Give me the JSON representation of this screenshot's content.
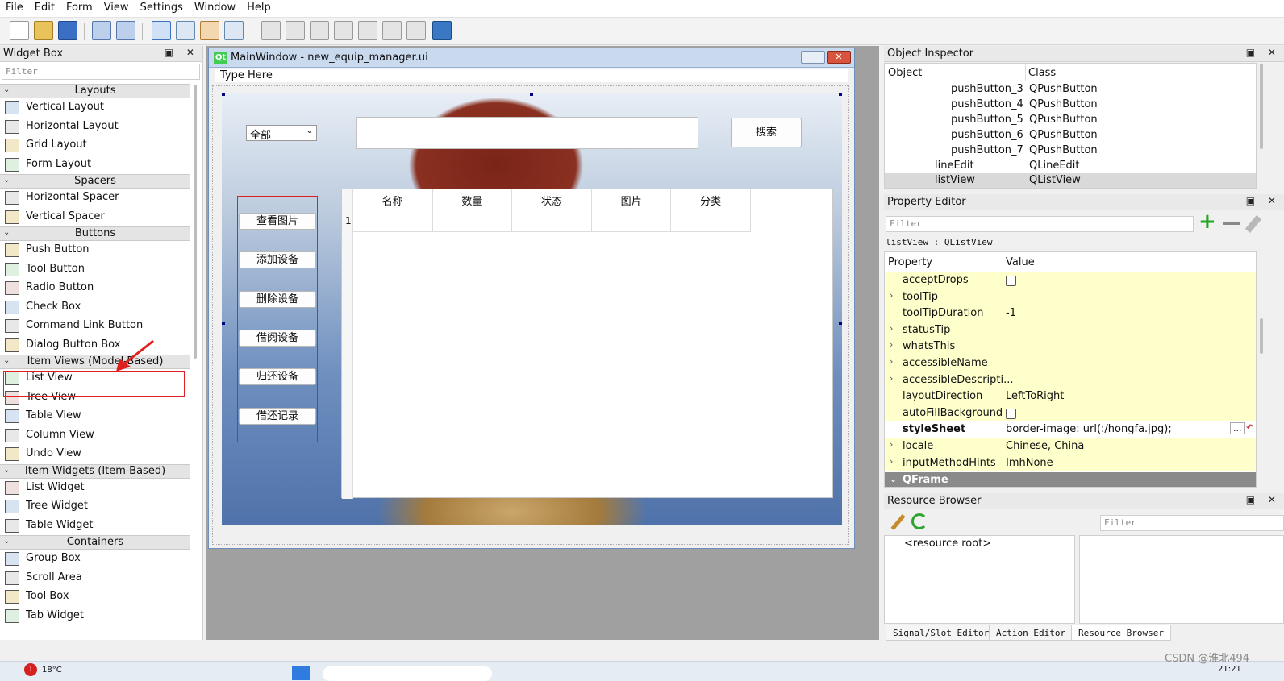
{
  "menu": [
    "File",
    "Edit",
    "Form",
    "View",
    "Settings",
    "Window",
    "Help"
  ],
  "widget_box": {
    "title": "Widget Box",
    "dock_buttons": "▣ ✕",
    "filter_placeholder": "Filter",
    "categories": [
      {
        "name": "Layouts",
        "items": [
          "Vertical Layout",
          "Horizontal Layout",
          "Grid Layout",
          "Form Layout"
        ]
      },
      {
        "name": "Spacers",
        "items": [
          "Horizontal Spacer",
          "Vertical Spacer"
        ]
      },
      {
        "name": "Buttons",
        "items": [
          "Push Button",
          "Tool Button",
          "Radio Button",
          "Check Box",
          "Command Link Button",
          "Dialog Button Box"
        ]
      },
      {
        "name": "Item Views (Model-Based)",
        "items": [
          "List View",
          "Tree View",
          "Table View",
          "Column View",
          "Undo View"
        ]
      },
      {
        "name": "Item Widgets (Item-Based)",
        "items": [
          "List Widget",
          "Tree Widget",
          "Table Widget"
        ]
      },
      {
        "name": "Containers",
        "items": [
          "Group Box",
          "Scroll Area",
          "Tool Box",
          "Tab Widget"
        ]
      }
    ]
  },
  "form": {
    "title": "MainWindow - new_equip_manager.ui",
    "qt_badge": "Qt",
    "menu_placeholder": "Type Here",
    "combo_value": "全部",
    "search_button": "搜索",
    "side_buttons": [
      "查看图片",
      "添加设备",
      "删除设备",
      "借阅设备",
      "归还设备",
      "借还记录"
    ],
    "table_headers": [
      "名称",
      "数量",
      "状态",
      "图片",
      "分类"
    ],
    "table_row_number": "1"
  },
  "object_inspector": {
    "title": "Object Inspector",
    "col_object": "Object",
    "col_class": "Class",
    "rows": [
      {
        "object": "pushButton_3",
        "class": "QPushButton"
      },
      {
        "object": "pushButton_4",
        "class": "QPushButton"
      },
      {
        "object": "pushButton_5",
        "class": "QPushButton"
      },
      {
        "object": "pushButton_6",
        "class": "QPushButton"
      },
      {
        "object": "pushButton_7",
        "class": "QPushButton"
      },
      {
        "object": "lineEdit",
        "class": "QLineEdit"
      },
      {
        "object": "listView",
        "class": "QListView"
      }
    ]
  },
  "property_editor": {
    "title": "Property Editor",
    "filter_placeholder": "Filter",
    "object_label": "listView : QListView",
    "col_property": "Property",
    "col_value": "Value",
    "rows": [
      {
        "name": "acceptDrops",
        "value": "",
        "checkbox": true,
        "expand": false
      },
      {
        "name": "toolTip",
        "value": "",
        "checkbox": false,
        "expand": true
      },
      {
        "name": "toolTipDuration",
        "value": "-1",
        "checkbox": false,
        "expand": false
      },
      {
        "name": "statusTip",
        "value": "",
        "checkbox": false,
        "expand": true
      },
      {
        "name": "whatsThis",
        "value": "",
        "checkbox": false,
        "expand": true
      },
      {
        "name": "accessibleName",
        "value": "",
        "checkbox": false,
        "expand": true
      },
      {
        "name": "accessibleDescripti...",
        "value": "",
        "checkbox": false,
        "expand": true
      },
      {
        "name": "layoutDirection",
        "value": "LeftToRight",
        "checkbox": false,
        "expand": false
      },
      {
        "name": "autoFillBackground",
        "value": "",
        "checkbox": true,
        "expand": false
      },
      {
        "name": "styleSheet",
        "value": "border-image: url(:/hongfa.jpg);",
        "checkbox": false,
        "expand": false
      },
      {
        "name": "locale",
        "value": "Chinese, China",
        "checkbox": false,
        "expand": true
      },
      {
        "name": "inputMethodHints",
        "value": "ImhNone",
        "checkbox": false,
        "expand": true
      }
    ],
    "section": "QFrame"
  },
  "resource_browser": {
    "title": "Resource Browser",
    "filter_placeholder": "Filter",
    "root": "<resource root>",
    "tabs": [
      "Signal/Slot Editor",
      "Action Editor",
      "Resource Browser"
    ]
  },
  "taskbar": {
    "badge": "1",
    "temperature": "18°C",
    "time": "21:21",
    "watermark": "CSDN @淮北494"
  },
  "colors": {
    "accent": "#1e5fd0",
    "highlight_red": "#e02020",
    "property_bg": "#ffffcc",
    "section_bg": "#8a8a8a"
  }
}
